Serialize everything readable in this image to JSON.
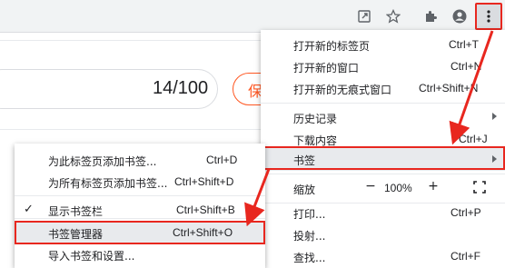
{
  "toolbar": {
    "icons": [
      "share-icon",
      "star-icon",
      "extensions-icon",
      "profile-icon",
      "more-menu-icon"
    ]
  },
  "page": {
    "counter": "14/100",
    "save_button": "保"
  },
  "main_menu": {
    "items": [
      {
        "label": "打开新的标签页",
        "shortcut": "Ctrl+T"
      },
      {
        "label": "打开新的窗口",
        "shortcut": "Ctrl+N"
      },
      {
        "label": "打开新的无痕式窗口",
        "shortcut": "Ctrl+Shift+N"
      },
      {
        "label": "历史记录",
        "shortcut": ""
      },
      {
        "label": "下载内容",
        "shortcut": "Ctrl+J"
      },
      {
        "label": "书签",
        "shortcut": ""
      },
      {
        "label": "缩放",
        "shortcut": ""
      },
      {
        "label": "打印...",
        "shortcut": "Ctrl+P"
      },
      {
        "label": "投射...",
        "shortcut": ""
      },
      {
        "label": "查找...",
        "shortcut": "Ctrl+F"
      }
    ],
    "zoom": {
      "minus": "−",
      "value": "100%",
      "plus": "+"
    }
  },
  "bookmarks_submenu": {
    "items": [
      {
        "label": "为此标签页添加书签...",
        "shortcut": "Ctrl+D"
      },
      {
        "label": "为所有标签页添加书签...",
        "shortcut": "Ctrl+Shift+D"
      },
      {
        "label": "显示书签栏",
        "shortcut": "Ctrl+Shift+B",
        "checked": true
      },
      {
        "label": "书签管理器",
        "shortcut": "Ctrl+Shift+O"
      },
      {
        "label": "导入书签和设置...",
        "shortcut": ""
      }
    ],
    "check_mark": "✓"
  },
  "colors": {
    "highlight_border": "#e8271f",
    "save_accent": "#ff5722",
    "menu_hover": "#e8eaed"
  }
}
